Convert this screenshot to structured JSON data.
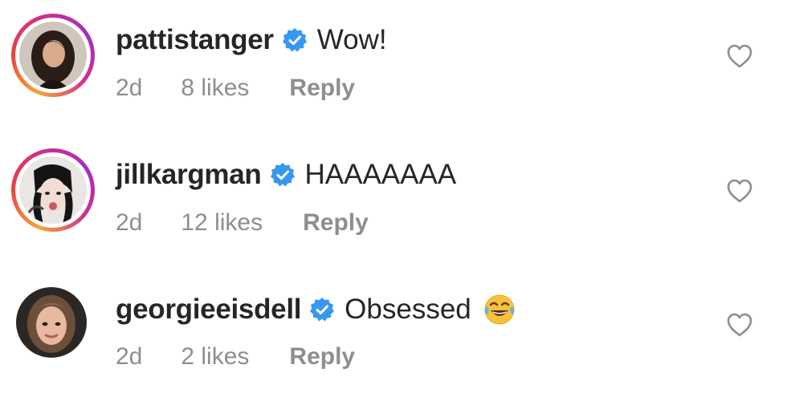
{
  "comments": [
    {
      "username": "pattistanger",
      "verified": true,
      "text": "Wow!",
      "time": "2d",
      "likes": "8 likes",
      "reply_label": "Reply",
      "has_story_ring": true,
      "emoji": ""
    },
    {
      "username": "jillkargman",
      "verified": true,
      "text": "HAAAAAAA",
      "time": "2d",
      "likes": "12 likes",
      "reply_label": "Reply",
      "has_story_ring": true,
      "emoji": ""
    },
    {
      "username": "georgieeisdell",
      "verified": true,
      "text": "Obsessed",
      "time": "2d",
      "likes": "2 likes",
      "reply_label": "Reply",
      "has_story_ring": false,
      "emoji": "tears-of-joy-emoji"
    }
  ],
  "colors": {
    "verified_badge": "#3897f0",
    "meta_text": "#8e8e8e",
    "primary_text": "#262626",
    "heart_outline": "#8e8e8e"
  },
  "icons": {
    "verified": "verified-badge-icon",
    "like": "heart-outline-icon"
  }
}
